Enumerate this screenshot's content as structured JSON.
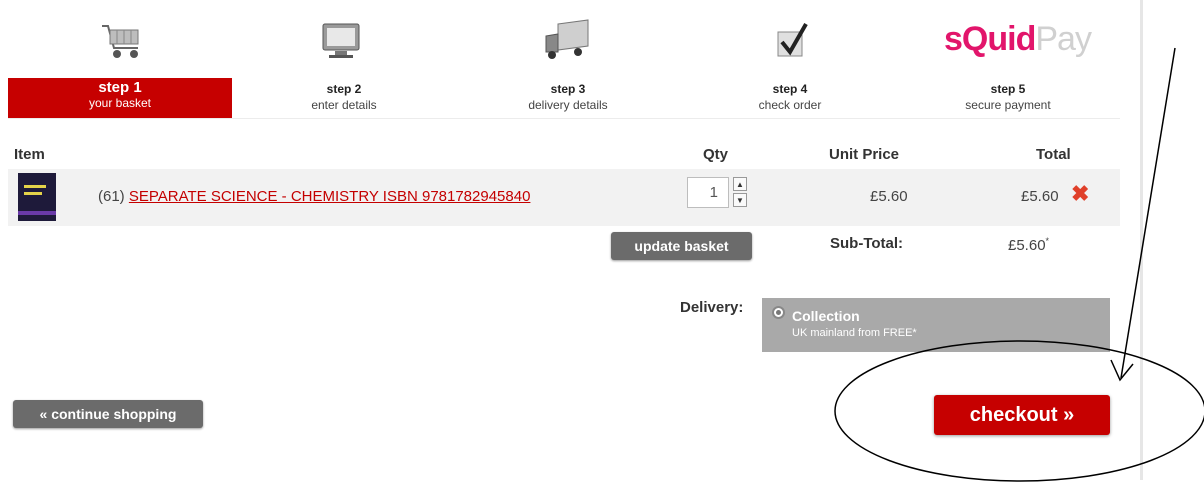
{
  "brand": {
    "part1": "s",
    "part2": "Quid",
    "part3": "Pay"
  },
  "steps": [
    {
      "num": "step 1",
      "desc": "your basket"
    },
    {
      "num": "step 2",
      "desc": "enter details"
    },
    {
      "num": "step 3",
      "desc": "delivery details"
    },
    {
      "num": "step 4",
      "desc": "check order"
    },
    {
      "num": "step 5",
      "desc": "secure payment"
    }
  ],
  "table": {
    "headers": {
      "item": "Item",
      "qty": "Qty",
      "unit_price": "Unit Price",
      "total": "Total"
    },
    "row": {
      "prefix": "(61)",
      "title": "SEPARATE SCIENCE - CHEMISTRY ISBN 9781782945840",
      "qty": "1",
      "unit_price": "£5.60",
      "total": "£5.60",
      "remove_glyph": "✖"
    }
  },
  "update_label": "update basket",
  "subtotal": {
    "label": "Sub-Total:",
    "value": "£5.60",
    "mark": "*"
  },
  "delivery": {
    "label": "Delivery:",
    "option_title": "Collection",
    "option_sub": "UK mainland from FREE*"
  },
  "continue_label": "« continue shopping",
  "checkout_label": "checkout »",
  "colors": {
    "accent": "#c60000",
    "brand": "#e2156b",
    "button_grey": "#6b6b6b"
  },
  "icons": [
    "basket-icon",
    "monitor-icon",
    "delivery-truck-icon",
    "checkmark-icon"
  ]
}
